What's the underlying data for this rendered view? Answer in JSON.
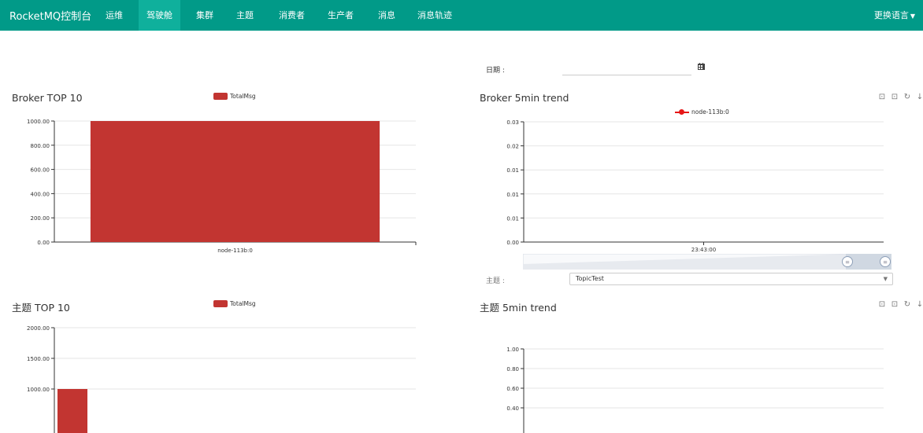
{
  "navbar": {
    "brand": "RocketMQ控制台",
    "items": [
      {
        "label": "运维"
      },
      {
        "label": "驾驶舱"
      },
      {
        "label": "集群"
      },
      {
        "label": "主题"
      },
      {
        "label": "消费者"
      },
      {
        "label": "生产者"
      },
      {
        "label": "消息"
      },
      {
        "label": "消息轨迹"
      }
    ],
    "active_item": "驾驶舱",
    "language_label": "更换语言",
    "bg_color": "#019a88",
    "active_color": "#0fb09c"
  },
  "date_filter": {
    "label": "日期 :",
    "value": "",
    "icon": "calendar-icon"
  },
  "topic_filter": {
    "label": "主题 :",
    "selected": "TopicTest"
  },
  "toolbox_icons": [
    "zoom-icon",
    "zoom-reset-icon",
    "restore-icon",
    "download-icon"
  ],
  "panels": {
    "broker_top": {
      "title": "Broker TOP 10",
      "legend": "TotalMsg",
      "chart_data": {
        "type": "bar",
        "categories": [
          "node-113b:0"
        ],
        "series": [
          {
            "name": "TotalMsg",
            "values": [
              1000
            ]
          }
        ],
        "ylim": [
          0,
          1000
        ],
        "y_ticks": [
          "0.00",
          "200.00",
          "400.00",
          "600.00",
          "800.00",
          "1000.00"
        ],
        "grid": true,
        "color": "#c23531"
      }
    },
    "broker_trend": {
      "title": "Broker 5min trend",
      "legend": "node-113b:0",
      "chart_data": {
        "type": "line",
        "x": [
          "23:43:00"
        ],
        "series": [
          {
            "name": "node-113b:0",
            "values": []
          }
        ],
        "y_ticks": [
          "0.00",
          "0.01",
          "0.01",
          "0.01",
          "0.02",
          "0.03"
        ],
        "grid": true,
        "color": "#e61717"
      }
    },
    "topic_top": {
      "title": "主题 TOP 10",
      "legend": "TotalMsg",
      "chart_data": {
        "type": "bar",
        "categories": [
          ""
        ],
        "series": [
          {
            "name": "TotalMsg",
            "values": [
              1000
            ]
          }
        ],
        "y_ticks": [
          "1000.00",
          "1500.00",
          "2000.00"
        ],
        "grid": true,
        "color": "#c23531"
      }
    },
    "topic_trend": {
      "title": "主题 5min trend",
      "chart_data": {
        "type": "line",
        "series": [],
        "y_ticks": [
          "0.40",
          "0.60",
          "0.80",
          "1.00"
        ],
        "grid": true
      }
    }
  }
}
